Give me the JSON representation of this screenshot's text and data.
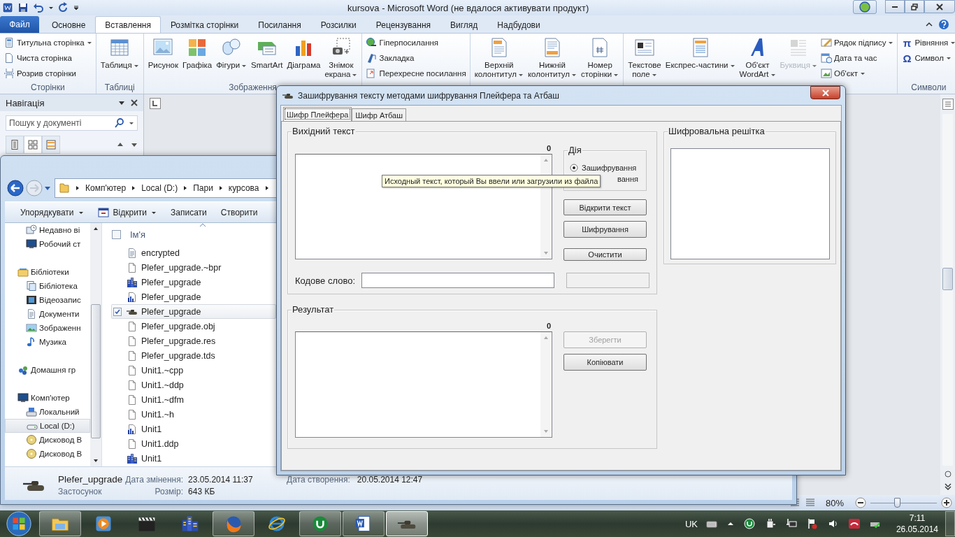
{
  "word": {
    "title": "kursova  -  Microsoft Word (не вдалося активувати продукт)",
    "tabs": [
      {
        "label": "Файл",
        "kind": "file",
        "selected": false
      },
      {
        "label": "Основне",
        "kind": "tab",
        "selected": false
      },
      {
        "label": "Вставлення",
        "kind": "tab",
        "selected": true
      },
      {
        "label": "Розмітка сторінки",
        "kind": "tab",
        "selected": false
      },
      {
        "label": "Посилання",
        "kind": "tab",
        "selected": false
      },
      {
        "label": "Розсилки",
        "kind": "tab",
        "selected": false
      },
      {
        "label": "Рецензування",
        "kind": "tab",
        "selected": false
      },
      {
        "label": "Вигляд",
        "kind": "tab",
        "selected": false
      },
      {
        "label": "Надбудови",
        "kind": "tab",
        "selected": false
      }
    ],
    "ribbon_groups": [
      {
        "label": "Сторінки",
        "items": [
          {
            "label": "Титульна сторінка",
            "kind": "small",
            "dropdown": true,
            "disabled": false
          },
          {
            "label": "Чиста сторінка",
            "kind": "small",
            "dropdown": false,
            "disabled": false
          },
          {
            "label": "Розрив сторінки",
            "kind": "small",
            "dropdown": false,
            "disabled": false
          }
        ]
      },
      {
        "label": "Таблиці",
        "items": [
          {
            "label": "Таблиця",
            "kind": "large",
            "dropdown": true,
            "disabled": false
          }
        ]
      },
      {
        "label": "Зображення",
        "items": [
          {
            "label": "Рисунок",
            "kind": "large",
            "dropdown": false,
            "disabled": false
          },
          {
            "label": "Графіка",
            "kind": "large",
            "dropdown": false,
            "disabled": false
          },
          {
            "label": "Фігури",
            "kind": "large",
            "dropdown": true,
            "disabled": false
          },
          {
            "label": "SmartArt",
            "kind": "large",
            "dropdown": false,
            "disabled": false
          },
          {
            "label": "Діаграма",
            "kind": "large",
            "dropdown": false,
            "disabled": false
          },
          {
            "label": "Знімок\nекрана",
            "kind": "large",
            "dropdown": true,
            "disabled": false
          }
        ]
      },
      {
        "items": [
          {
            "label": "Гіперпосилання",
            "kind": "small",
            "dropdown": false,
            "disabled": false
          },
          {
            "label": "Закладка",
            "kind": "small",
            "dropdown": false,
            "disabled": false
          },
          {
            "label": "Перехресне посилання",
            "kind": "small",
            "dropdown": false,
            "disabled": false
          }
        ]
      },
      {
        "items": [
          {
            "label": "Верхній\nколонтитул",
            "kind": "large",
            "dropdown": true,
            "disabled": false
          },
          {
            "label": "Нижній\nколонтитул",
            "kind": "large",
            "dropdown": true,
            "disabled": false
          },
          {
            "label": "Номер\nсторінки",
            "kind": "large",
            "dropdown": true,
            "disabled": false
          }
        ]
      },
      {
        "items": [
          {
            "label": "Текстове\nполе",
            "kind": "large",
            "dropdown": true,
            "disabled": false
          },
          {
            "label": "Експрес-частини",
            "kind": "large",
            "dropdown": true,
            "disabled": false
          },
          {
            "label": "Об'єкт\nWordArt",
            "kind": "large",
            "dropdown": true,
            "disabled": false
          },
          {
            "label": "Буквиця",
            "kind": "large",
            "dropdown": true,
            "disabled": true
          },
          {
            "label": "Рядок підпису",
            "kind": "small",
            "dropdown": true,
            "disabled": false
          },
          {
            "label": "Дата та час",
            "kind": "small",
            "dropdown": false,
            "disabled": false
          },
          {
            "label": "Об'єкт",
            "kind": "small",
            "dropdown": true,
            "disabled": false
          }
        ]
      },
      {
        "label": "Символи",
        "items": [
          {
            "label": "Рівняння",
            "glyph": "π",
            "kind": "small",
            "dropdown": true,
            "disabled": false
          },
          {
            "label": "Символ",
            "glyph": "Ω",
            "kind": "small",
            "dropdown": true,
            "disabled": false
          }
        ]
      }
    ],
    "navigation": {
      "title": "Навігація",
      "search": {
        "placeholder": "Пошук у документі"
      },
      "views": [
        {
          "selected": false
        },
        {
          "selected": true
        },
        {
          "selected": false
        }
      ]
    },
    "status_bar": {
      "zoom": "80%",
      "zoom_slider": {
        "level": 0.4
      }
    }
  },
  "explorer": {
    "breadcrumb": [
      "Комп'ютер",
      "Local (D:)",
      "Пари",
      "курсова"
    ],
    "toolbar": [
      {
        "label": "Упорядкувати",
        "dropdown": true
      },
      {
        "label": "Відкрити",
        "dropdown": true
      },
      {
        "label": "Записати",
        "dropdown": false
      },
      {
        "label": "Створити",
        "dropdown": false
      }
    ],
    "favorites": [
      {
        "label": "Недавно ві",
        "kind": "recent",
        "selected": false
      },
      {
        "label": "Робочий ст",
        "kind": "desktop",
        "selected": false
      }
    ],
    "tree": [
      {
        "label": "Бібліотеки",
        "kind": "libraries",
        "selected": false,
        "children": [
          {
            "label": "Бібліотека",
            "kind": "library",
            "selected": false
          },
          {
            "label": "Відеозапис",
            "kind": "video",
            "selected": false
          },
          {
            "label": "Документи",
            "kind": "documents",
            "selected": false
          },
          {
            "label": "Зображенн",
            "kind": "pictures",
            "selected": false
          },
          {
            "label": "Музика",
            "kind": "music",
            "selected": false
          }
        ]
      },
      {
        "label": "Домашня гр",
        "kind": "homegroup",
        "selected": false
      },
      {
        "label": "Комп'ютер",
        "kind": "computer",
        "selected": false,
        "children": [
          {
            "label": "Локальний",
            "kind": "system-drive",
            "selected": false
          },
          {
            "label": "Local (D:)",
            "kind": "drive",
            "selected": true
          },
          {
            "label": "Дисковод В",
            "kind": "optical",
            "selected": false
          },
          {
            "label": "Дисковод В",
            "kind": "optical",
            "selected": false
          }
        ]
      }
    ],
    "select_all": {
      "checked": false
    },
    "column_header": "Ім'я",
    "files": [
      {
        "name": "encrypted",
        "kind": "text",
        "selected": false,
        "checked": false
      },
      {
        "name": "Plefer_upgrade.~bpr",
        "kind": "blank",
        "selected": false,
        "checked": false
      },
      {
        "name": "Plefer_upgrade",
        "kind": "project",
        "selected": false,
        "checked": false
      },
      {
        "name": "Plefer_upgrade",
        "kind": "chart",
        "selected": false,
        "checked": false
      },
      {
        "name": "Plefer_upgrade",
        "kind": "app",
        "selected": true,
        "checked": true
      },
      {
        "name": "Plefer_upgrade.obj",
        "kind": "blank",
        "selected": false,
        "checked": false
      },
      {
        "name": "Plefer_upgrade.res",
        "kind": "blank",
        "selected": false,
        "checked": false
      },
      {
        "name": "Plefer_upgrade.tds",
        "kind": "blank",
        "selected": false,
        "checked": false
      },
      {
        "name": "Unit1.~cpp",
        "kind": "blank",
        "selected": false,
        "checked": false
      },
      {
        "name": "Unit1.~ddp",
        "kind": "blank",
        "selected": false,
        "checked": false
      },
      {
        "name": "Unit1.~dfm",
        "kind": "blank",
        "selected": false,
        "checked": false
      },
      {
        "name": "Unit1.~h",
        "kind": "blank",
        "selected": false,
        "checked": false
      },
      {
        "name": "Unit1",
        "kind": "chart",
        "selected": false,
        "checked": false
      },
      {
        "name": "Unit1.ddp",
        "kind": "blank",
        "selected": false,
        "checked": false
      },
      {
        "name": "Unit1",
        "kind": "project",
        "selected": false,
        "checked": false
      }
    ],
    "details": {
      "name": "Plefer_upgrade",
      "type": "Застосунок",
      "modified_label": "Дата змінення:",
      "modified": "23.05.2014 11:37",
      "size_label": "Розмір:",
      "size": "643 КБ",
      "created_label": "Дата створення:",
      "created": "20.05.2014 12:47"
    }
  },
  "dialog": {
    "title": "Зашифрування тексту методами шифрування Плейфера та Атбаш",
    "tabs": [
      {
        "label": "Шифр Плейфера",
        "selected": true
      },
      {
        "label": "Шифр Атбаш",
        "selected": false
      }
    ],
    "source": {
      "legend": "Вихідний текст",
      "count": "0"
    },
    "action": {
      "legend": "Дія",
      "options": [
        {
          "label": "Зашифрування",
          "selected": true
        },
        {
          "label": "вання"
        }
      ]
    },
    "buttons": [
      {
        "label": "Відкрити текст",
        "disabled": false
      },
      {
        "label": "Шифрування",
        "disabled": false
      },
      {
        "label": "Очистити",
        "disabled": false
      }
    ],
    "keyword": {
      "label": "Кодове слово:"
    },
    "result": {
      "legend": "Результат",
      "count": "0",
      "buttons": [
        {
          "label": "Зберегти",
          "disabled": true
        },
        {
          "label": "Копіювати",
          "disabled": false
        }
      ]
    },
    "grid": {
      "legend": "Шифровальна решітка"
    },
    "tooltip": "Исходный текст, который Вы ввели или загрузили из файла"
  },
  "taskbar": {
    "apps": [
      {
        "running": true,
        "selected": false
      },
      {
        "running": false,
        "selected": false
      },
      {
        "running": false,
        "selected": false
      },
      {
        "running": false,
        "selected": false
      },
      {
        "running": true,
        "selected": false
      },
      {
        "running": false,
        "selected": false
      },
      {
        "running": true,
        "selected": false
      },
      {
        "running": true,
        "selected": false
      },
      {
        "running": true,
        "selected": true
      }
    ],
    "language": "UK",
    "time": "7:11",
    "date": "26.05.2014"
  }
}
